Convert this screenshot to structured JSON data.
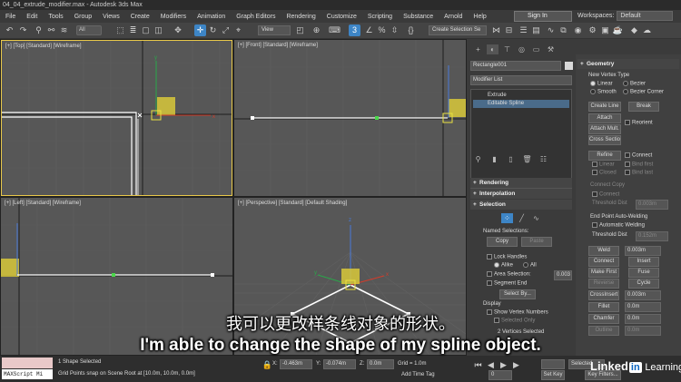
{
  "window": {
    "title": "04_04_extrude_modifier.max - Autodesk 3ds Max"
  },
  "menubar": {
    "items": [
      "File",
      "Edit",
      "Tools",
      "Group",
      "Views",
      "Create",
      "Modifiers",
      "Animation",
      "Graph Editors",
      "Rendering",
      "Customize",
      "Scripting",
      "Substance",
      "Arnold",
      "Help"
    ],
    "signin": "Sign In",
    "workspaces_label": "Workspaces:",
    "workspaces_value": "Default"
  },
  "toolbar": {
    "selection_filter": "All",
    "ref_coord": "View",
    "named_selection_set": "Create Selection Se"
  },
  "viewports": [
    {
      "label": "[+] [Top] [Standard] [Wireframe]"
    },
    {
      "label": "[+] [Front] [Standard] [Wireframe]"
    },
    {
      "label": "[+] [Left] [Standard] [Wireframe]"
    },
    {
      "label": "[+] [Perspective] [Standard] [Default Shading]"
    }
  ],
  "command_panel": {
    "object_name": "Rectangle001",
    "modifier_list": "Modifier List",
    "stack": [
      "Extrude",
      "Editable Spline"
    ],
    "rollouts": {
      "rendering": "Rendering",
      "interpolation": "Interpolation",
      "selection": "Selection"
    },
    "selection": {
      "named_selections": "Named Selections:",
      "copy": "Copy",
      "paste": "Paste",
      "lock_handles": "Lock Handles",
      "alike": "Alike",
      "all": "All",
      "area_selection": "Area Selection:",
      "area_value": "0.003",
      "segment_end": "Segment End",
      "select_by": "Select By...",
      "display": "Display",
      "show_vertex_numbers": "Show Vertex Numbers",
      "selected_only": "Selected Only",
      "status": "2 Vertices Selected"
    }
  },
  "geometry": {
    "title": "Geometry",
    "new_vertex_type": "New Vertex Type",
    "linear": "Linear",
    "bezier": "Bezier",
    "smooth": "Smooth",
    "bezier_corner": "Bezier Corner",
    "create_line": "Create Line",
    "break": "Break",
    "attach": "Attach",
    "reorient": "Reorient",
    "attach_mult": "Attach Mult.",
    "cross_section": "Cross Section",
    "refine": "Refine",
    "connect": "Connect",
    "linear2": "Linear",
    "bind_first": "Bind first",
    "closed": "Closed",
    "bind_last": "Bind last",
    "connect_copy": "Connect Copy",
    "connect2": "Connect",
    "threshold_distance": "Threshold Dist",
    "threshold_value": "0.003m",
    "end_point_auto_welding": "End Point Auto-Welding",
    "automatic_welding": "Automatic Welding",
    "threshold_distance2": "Threshold Dist",
    "threshold_value2": "0.152m",
    "weld": "Weld",
    "weld_value": "0.003m",
    "connect_btn": "Connect",
    "insert": "Insert",
    "make_first": "Make First",
    "fuse": "Fuse",
    "reverse": "Reverse",
    "cycle": "Cycle",
    "crossinsert": "CrossInsert",
    "crossinsert_value": "0.003m",
    "fillet": "Fillet",
    "fillet_value": "0.0m",
    "chamfer": "Chamfer",
    "chamfer_value": "0.0m",
    "outline": "Outline",
    "outline_value": "0.0m"
  },
  "statusbar": {
    "maxscript": "MAXScript Mi",
    "selection_status": "1 Shape Selected",
    "prompt": "Grid Points snap on Scene Root at [10.0m, 10.0m, 0.0m]",
    "x_label": "X:",
    "x": "-0.463m",
    "y_label": "Y:",
    "y": "-0.074m",
    "z_label": "Z:",
    "z": "0.0m",
    "grid": "Grid = 1.0m",
    "add_time_tag": "Add Time Tag",
    "frame": "0",
    "set_key": "Set Key",
    "key_filters": "Key Filters...",
    "selected": "Selected"
  },
  "subtitles": {
    "chinese": "我可以更改样条线对象的形状。",
    "english": "I'm able to change the shape of my spline object."
  },
  "watermark": {
    "brand": "Linked",
    "brand_in": "in",
    "brand_tail": "Learning"
  },
  "colors": {
    "accent": "#3d85c6",
    "viewport_bg": "#575757",
    "active_border": "#e8c84a",
    "gizmo_yellow": "#d8c83a"
  }
}
